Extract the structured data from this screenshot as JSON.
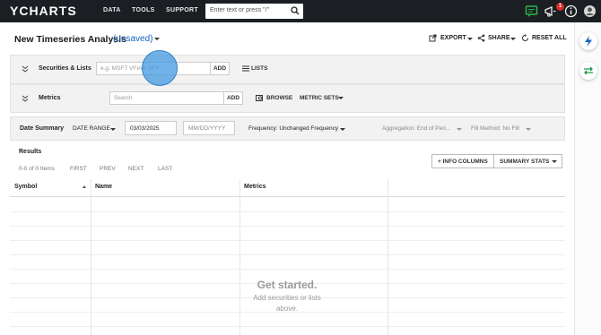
{
  "topbar": {
    "logo": "YCHARTS",
    "nav": [
      "DATA",
      "TOOLS",
      "SUPPORT"
    ],
    "search_placeholder": "Enter text or press \"/\"",
    "notifications_badge": "1"
  },
  "header": {
    "title": "New Timeseries Analysis",
    "status": "(unsaved)",
    "export_label": "EXPORT",
    "share_label": "SHARE",
    "reset_label": "RESET ALL"
  },
  "securities": {
    "label": "Securities & Lists",
    "placeholder": "e.g. MSFT VFIAX SPY",
    "add_label": "ADD",
    "lists_label": "LISTS"
  },
  "metrics": {
    "label": "Metrics",
    "placeholder": "Search",
    "add_label": "ADD",
    "browse_label": "BROWSE",
    "metric_sets_label": "METRIC SETS"
  },
  "date_summary": {
    "label": "Date Summary",
    "date_range_label": "DATE RANGE",
    "start_date": "03/03/2025",
    "end_placeholder": "MM/DD/YYYY",
    "frequency": "Frequency: Unchanged Frequency",
    "aggregation": "Aggregation: End of Peri...",
    "fill_method": "Fill Method: No Fill"
  },
  "results": {
    "title": "Results",
    "count": "0-0 of 0 Items",
    "pager": [
      "FIRST",
      "PREV",
      "NEXT",
      "LAST"
    ],
    "info_columns_label": "+ INFO COLUMNS",
    "summary_stats_label": "SUMMARY STATS"
  },
  "table": {
    "headers": [
      "Symbol",
      "Name",
      "Metrics"
    ],
    "empty_title": "Get started.",
    "empty_subtitle": "Add securities or lists above."
  },
  "colors": {
    "topbar_bg": "#1b1e22",
    "accent_blue": "#1565c0",
    "panel_bg": "#f2f2f2",
    "chat_green": "#2db34a",
    "badge_red": "#d62b2b"
  },
  "icons": [
    "chat-icon",
    "megaphone-icon",
    "info-icon",
    "user-icon",
    "bolt-icon",
    "swap-icon",
    "search-icon"
  ]
}
